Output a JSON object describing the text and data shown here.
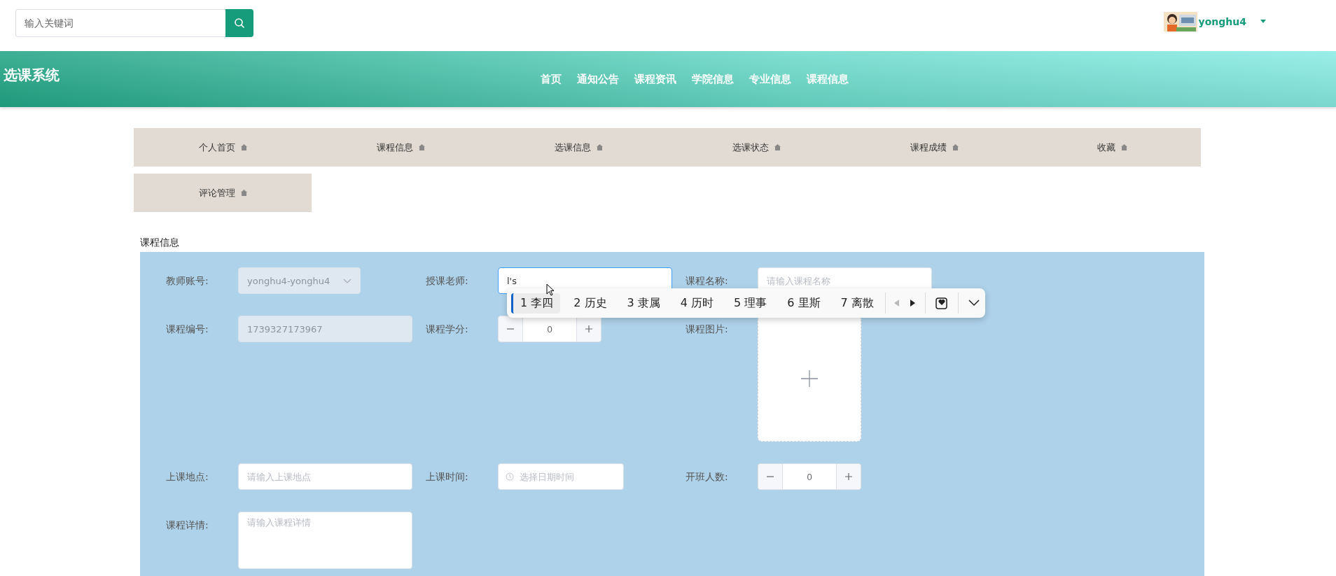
{
  "search": {
    "placeholder": "输入关键词"
  },
  "user": {
    "name": "yonghu4"
  },
  "header": {
    "title": "选课系统",
    "nav": [
      {
        "label": "首页"
      },
      {
        "label": "通知公告"
      },
      {
        "label": "课程资讯"
      },
      {
        "label": "学院信息"
      },
      {
        "label": "专业信息"
      },
      {
        "label": "课程信息"
      }
    ]
  },
  "menu": [
    {
      "label": "个人首页"
    },
    {
      "label": "课程信息"
    },
    {
      "label": "选课信息"
    },
    {
      "label": "选课状态"
    },
    {
      "label": "课程成绩"
    },
    {
      "label": "收藏"
    },
    {
      "label": "评论管理"
    }
  ],
  "section_title": "课程信息",
  "form": {
    "rows": [
      [
        {
          "kind": "select",
          "label": "教师账号:",
          "value": "yonghu4-yonghu4",
          "disabled": true
        },
        {
          "kind": "text",
          "label": "授课老师:",
          "value": "l's",
          "focused": true,
          "disabled": false
        },
        {
          "kind": "text",
          "label": "课程名称:",
          "placeholder": "请输入课程名称",
          "focused": false,
          "disabled": false
        }
      ],
      [
        {
          "kind": "text",
          "label": "课程编号:",
          "value": "1739327173967",
          "focused": false,
          "disabled": true
        },
        {
          "kind": "number",
          "label": "课程学分:",
          "value": "0"
        },
        {
          "kind": "upload",
          "label": "课程图片:"
        }
      ],
      [
        {
          "kind": "text",
          "label": "上课地点:",
          "placeholder": "请输入上课地点",
          "focused": false,
          "disabled": false
        },
        {
          "kind": "datetime",
          "label": "上课时间:",
          "placeholder": "选择日期时间"
        },
        {
          "kind": "number",
          "label": "开班人数:",
          "value": "0"
        }
      ],
      [
        {
          "kind": "textarea",
          "label": "课程详情:",
          "placeholder": "请输入课程详情"
        }
      ]
    ]
  },
  "ime": {
    "candidates": [
      {
        "index": "1",
        "text": "李四",
        "selected": true
      },
      {
        "index": "2",
        "text": "历史",
        "selected": false
      },
      {
        "index": "3",
        "text": "隶属",
        "selected": false
      },
      {
        "index": "4",
        "text": "历时",
        "selected": false
      },
      {
        "index": "5",
        "text": "理事",
        "selected": false
      },
      {
        "index": "6",
        "text": "里斯",
        "selected": false
      },
      {
        "index": "7",
        "text": "离散",
        "selected": false
      }
    ]
  }
}
